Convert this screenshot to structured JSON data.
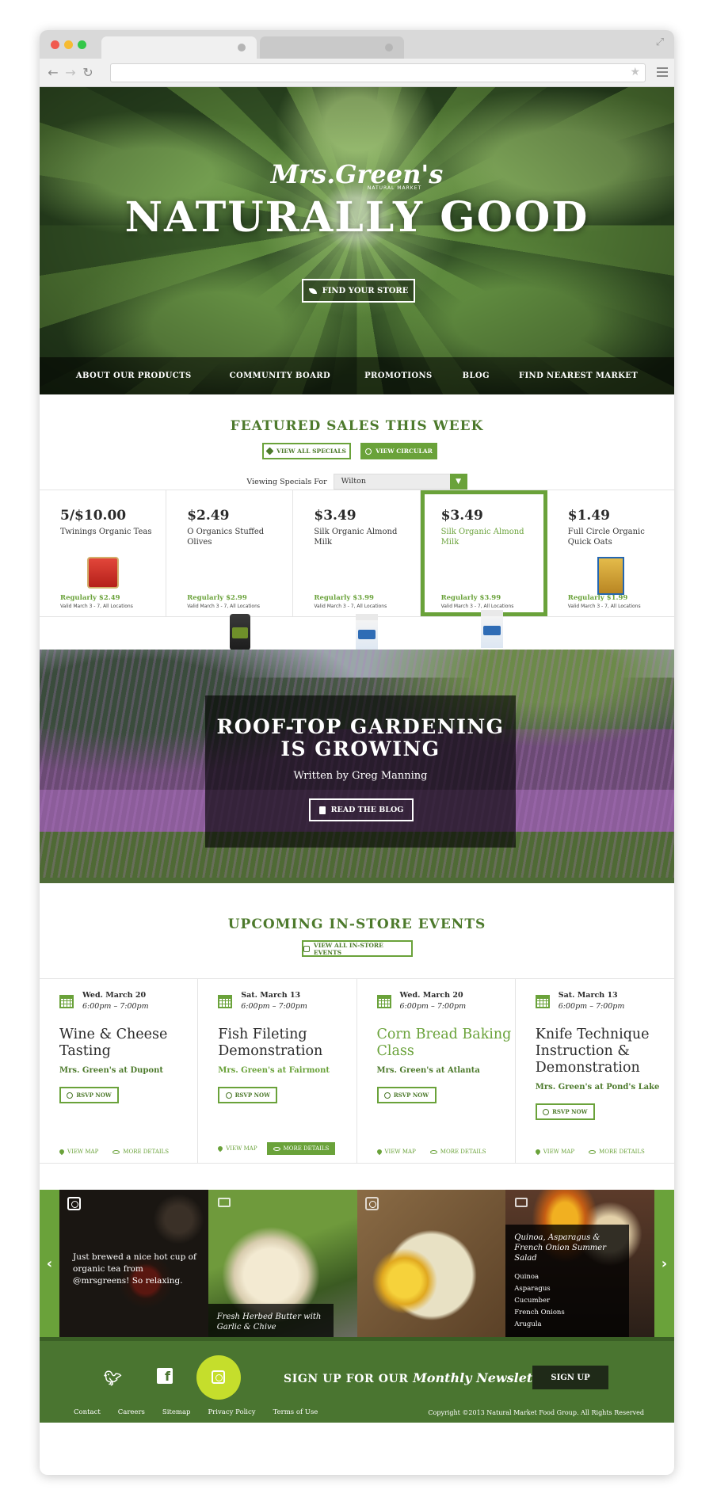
{
  "brand": {
    "name": "Mrs.Green's",
    "tagline": "NATURAL MARKET"
  },
  "hero": {
    "title": "NATURALLY GOOD",
    "cta_label": "FIND YOUR STORE"
  },
  "nav": {
    "items": [
      {
        "label": "ABOUT OUR PRODUCTS"
      },
      {
        "label": "COMMUNITY BOARD"
      },
      {
        "label": "PROMOTIONS"
      },
      {
        "label": "BLOG"
      },
      {
        "label": "FIND NEAREST MARKET"
      }
    ]
  },
  "featured": {
    "title": "FEATURED SALES THIS WEEK",
    "view_specials_label": "VIEW ALL SPECIALS",
    "view_circular_label": "VIEW CIRCULAR",
    "specials_for_label": "Viewing Specials For",
    "location_value": "Wilton"
  },
  "products": [
    {
      "price": "5/$10.00",
      "name": "Twinings Organic Teas",
      "regular": "Regularly $2.49",
      "valid": "Valid March 3 - 7, All Locations",
      "image_icon": "tea-tin"
    },
    {
      "price": "$2.49",
      "name": "O Organics Stuffed Olives",
      "regular": "Regularly $2.99",
      "valid": "Valid March 3 - 7, All Locations",
      "image_icon": "olive-jar"
    },
    {
      "price": "$3.49",
      "name": "Silk Organic Almond Milk",
      "regular": "Regularly $3.99",
      "valid": "Valid March 3 - 7, All Locations",
      "image_icon": "milk-carton"
    },
    {
      "price": "$3.49",
      "name": "Silk Organic Almond Milk",
      "regular": "Regularly $3.99",
      "valid": "Valid March 3 - 7, All Locations",
      "image_icon": "milk-carton"
    },
    {
      "price": "$1.49",
      "name": "Full Circle Organic Quick Oats",
      "regular": "Regularly $1.99",
      "valid": "Valid March 3 - 7, All Locations",
      "image_icon": "oats-box"
    }
  ],
  "blog_promo": {
    "title_line1": "ROOF-TOP GARDENING",
    "title_line2": "IS GROWING",
    "author": "Written by Greg Manning",
    "cta_label": "READ THE BLOG"
  },
  "events": {
    "title": "UPCOMING IN-STORE EVENTS",
    "view_all_label": "VIEW ALL IN-STORE EVENTS",
    "rsvp_label": "RSVP NOW",
    "map_label": "VIEW MAP",
    "details_label": "MORE DETAILS",
    "items": [
      {
        "date": "Wed. March 20",
        "time": "6:00pm – 7:00pm",
        "title": "Wine & Cheese Tasting",
        "location": "Mrs. Green's at Dupont"
      },
      {
        "date": "Sat. March 13",
        "time": "6:00pm – 7:00pm",
        "title": "Fish Fileting Demonstration",
        "location": "Mrs. Green's at Fairmont"
      },
      {
        "date": "Wed. March 20",
        "time": "6:00pm – 7:00pm",
        "title": "Corn Bread Baking Class",
        "location": "Mrs. Green's at Atlanta"
      },
      {
        "date": "Sat. March 13",
        "time": "6:00pm – 7:00pm",
        "title": "Knife Technique Instruction & Demonstration",
        "location": "Mrs. Green's at Pond's Lake"
      }
    ]
  },
  "social": {
    "tile1_text": "Just brewed a nice hot cup of organic tea from @mrsgreens! So relaxing.",
    "tile2_caption": "Fresh Herbed Butter with Garlic & Chive",
    "tile4_title": "Quinoa, Asparagus & French Onion Summer Salad",
    "tile4_ingredients": [
      "Quinoa",
      "Asparagus",
      "Cucumber",
      "French Onions",
      "Arugula"
    ]
  },
  "newsletter": {
    "text_prefix": "SIGN UP FOR OUR",
    "text_emphasis": "Monthly Newsletter",
    "signup_label": "SIGN UP"
  },
  "footer": {
    "links": [
      "Contact",
      "Careers",
      "Sitemap",
      "Privacy Policy",
      "Terms of Use"
    ],
    "copyright": "Copyright ©2013 Natural Market Food Group. All Rights Reserved"
  },
  "colors": {
    "accent": "#6aa23a",
    "dark_green": "#4a7530",
    "title_green": "#4d7a2c",
    "lime": "#c5de2c"
  }
}
